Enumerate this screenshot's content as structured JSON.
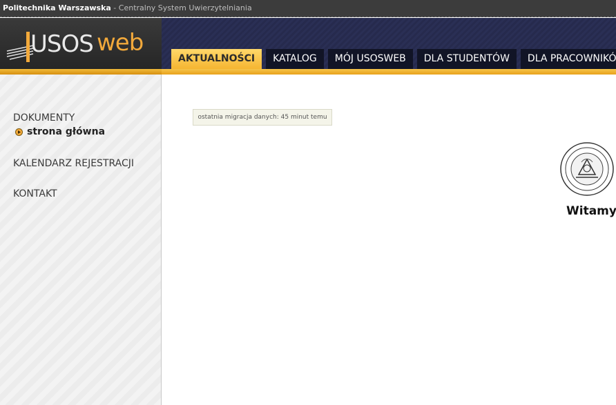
{
  "topbar": {
    "organization": "Politechnika Warszawska",
    "separator": " - ",
    "system": "Centralny System Uwierzytelniania"
  },
  "logo": {
    "part1": "USOS",
    "part2": "web",
    "accent_color": "#f2a93b"
  },
  "nav": {
    "tabs": [
      {
        "label": "AKTUALNOŚCI",
        "active": true
      },
      {
        "label": "KATALOG",
        "active": false
      },
      {
        "label": "MÓJ USOSWEB",
        "active": false
      },
      {
        "label": "DLA STUDENTÓW",
        "active": false
      },
      {
        "label": "DLA PRACOWNIKÓW",
        "active": false
      }
    ]
  },
  "sidebar": {
    "items": [
      {
        "label": "DOKUMENTY"
      },
      {
        "label": "strona główna",
        "current": true
      },
      {
        "label": "KALENDARZ REJESTRACJI"
      },
      {
        "label": "KONTAKT"
      }
    ]
  },
  "main": {
    "migration_info": "ostatnia migracja danych: 45 minut temu",
    "welcome": "Witamy w"
  },
  "colors": {
    "header_bg": "#2a2f55",
    "gold": "#f6c44b",
    "sidebar_bg": "#f3f3f3"
  }
}
